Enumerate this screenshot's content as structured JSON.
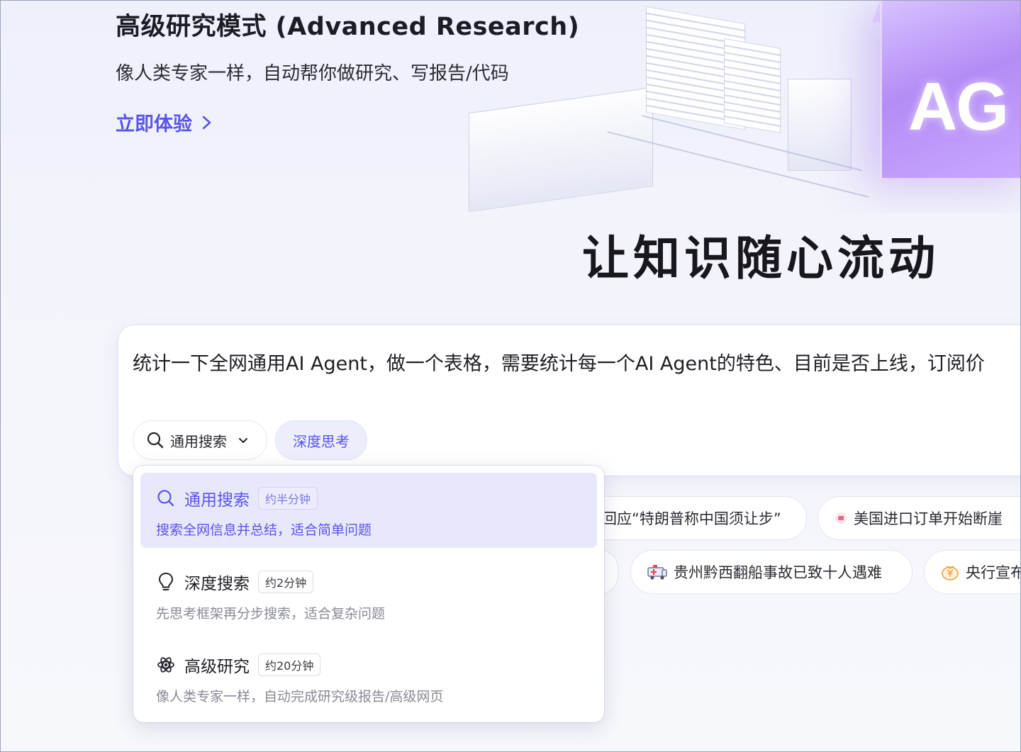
{
  "banner": {
    "title": "高级研究模式 (Advanced Research)",
    "subtitle": "像人类专家一样，自动帮你做研究、写报告/代码",
    "cta_label": "立即体验",
    "art_text": "AG"
  },
  "slogan": "让知识随心流动",
  "search": {
    "query": "统计一下全网通用AI Agent，做一个表格，需要统计每一个AI Agent的特色、目前是否上线，订阅价",
    "mode_label": "通用搜索",
    "deep_think_label": "深度思考"
  },
  "dropdown": {
    "options": [
      {
        "title": "通用搜索",
        "badge": "约半分钟",
        "desc": "搜索全网信息并总结，适合简单问题",
        "icon": "search-icon",
        "selected": true
      },
      {
        "title": "深度搜索",
        "badge": "约2分钟",
        "desc": "先思考框架再分步搜索，适合复杂问题",
        "icon": "lightbulb-icon",
        "selected": false
      },
      {
        "title": "高级研究",
        "badge": "约20分钟",
        "desc": "像人类专家一样，自动完成研究级报告/高级网页",
        "icon": "atom-icon",
        "selected": false
      }
    ]
  },
  "trending": [
    {
      "text": "回应“特朗普称中国须让步”",
      "icon": ""
    },
    {
      "text": "美国进口订单开始断崖",
      "icon": "news-dot-icon"
    },
    {
      "text": "贵州黔西翻船事故已致十人遇难",
      "icon": "ambulance-icon"
    },
    {
      "text": "央行宣布",
      "icon": "yuan-coin-icon"
    }
  ],
  "colors": {
    "accent": "#5a55e8",
    "cube": "#b48cf5",
    "selected_bg": "#e8e8fd"
  }
}
